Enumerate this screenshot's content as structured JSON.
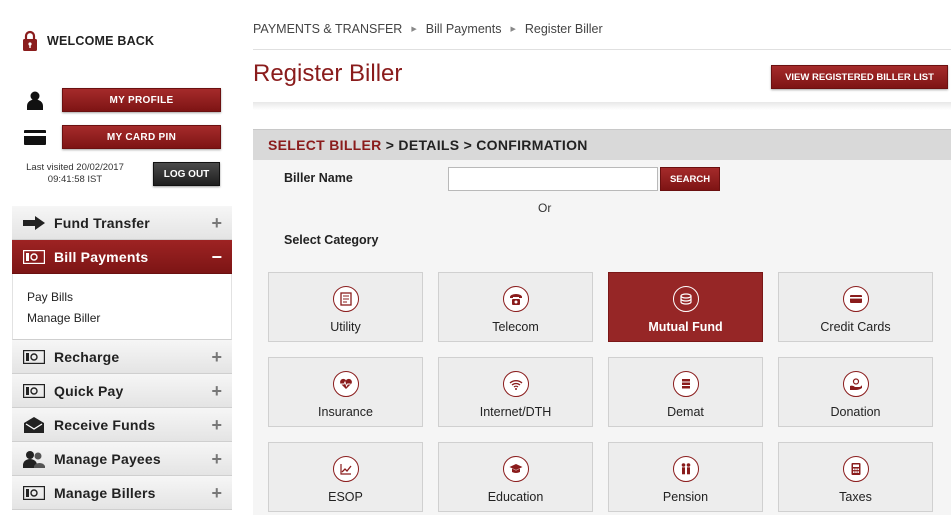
{
  "sidebar": {
    "welcome": "WELCOME BACK",
    "my_profile": "MY PROFILE",
    "my_card_pin": "MY CARD PIN",
    "last_visited_line1": "Last visited 20/02/2017",
    "last_visited_line2": "09:41:58 IST",
    "logout": "LOG OUT",
    "menu": [
      {
        "label": "Fund Transfer",
        "sign": "+",
        "icon": "arrow-icon"
      },
      {
        "label": "Bill Payments",
        "sign": "−",
        "icon": "money-icon",
        "active": true
      },
      {
        "label": "Recharge",
        "sign": "+",
        "icon": "money-icon"
      },
      {
        "label": "Quick Pay",
        "sign": "+",
        "icon": "money-icon"
      },
      {
        "label": "Receive Funds",
        "sign": "+",
        "icon": "envelope-icon"
      },
      {
        "label": "Manage Payees",
        "sign": "+",
        "icon": "people-icon"
      },
      {
        "label": "Manage Billers",
        "sign": "+",
        "icon": "money-icon"
      }
    ],
    "submenu": [
      "Pay Bills",
      "Manage Biller"
    ]
  },
  "header": {
    "breadcrumb": [
      "PAYMENTS & TRANSFER",
      "Bill Payments",
      "Register Biller"
    ],
    "title": "Register Biller",
    "view_registered": "VIEW REGISTERED BILLER LIST"
  },
  "steps": {
    "current": "SELECT BILLER",
    "rest": " > DETAILS > CONFIRMATION"
  },
  "form": {
    "biller_name_label": "Biller Name",
    "biller_name_value": "",
    "search_label": "SEARCH",
    "or": "Or",
    "category_label": "Select Category"
  },
  "categories": [
    {
      "label": "Utility",
      "icon": "bill-icon"
    },
    {
      "label": "Telecom",
      "icon": "phone-icon"
    },
    {
      "label": "Mutual Fund",
      "icon": "coins-icon",
      "selected": true
    },
    {
      "label": "Credit Cards",
      "icon": "card-icon"
    },
    {
      "label": "Insurance",
      "icon": "heart-icon"
    },
    {
      "label": "Internet/DTH",
      "icon": "wifi-icon"
    },
    {
      "label": "Demat",
      "icon": "stack-icon"
    },
    {
      "label": "Donation",
      "icon": "donation-icon"
    },
    {
      "label": "ESOP",
      "icon": "chart-icon"
    },
    {
      "label": "Education",
      "icon": "graduation-cap-icon"
    },
    {
      "label": "Pension",
      "icon": "people-icon"
    },
    {
      "label": "Taxes",
      "icon": "calculator-icon"
    }
  ],
  "colors": {
    "brand": "#8a1c1c",
    "active_menu": "#9e2323"
  }
}
